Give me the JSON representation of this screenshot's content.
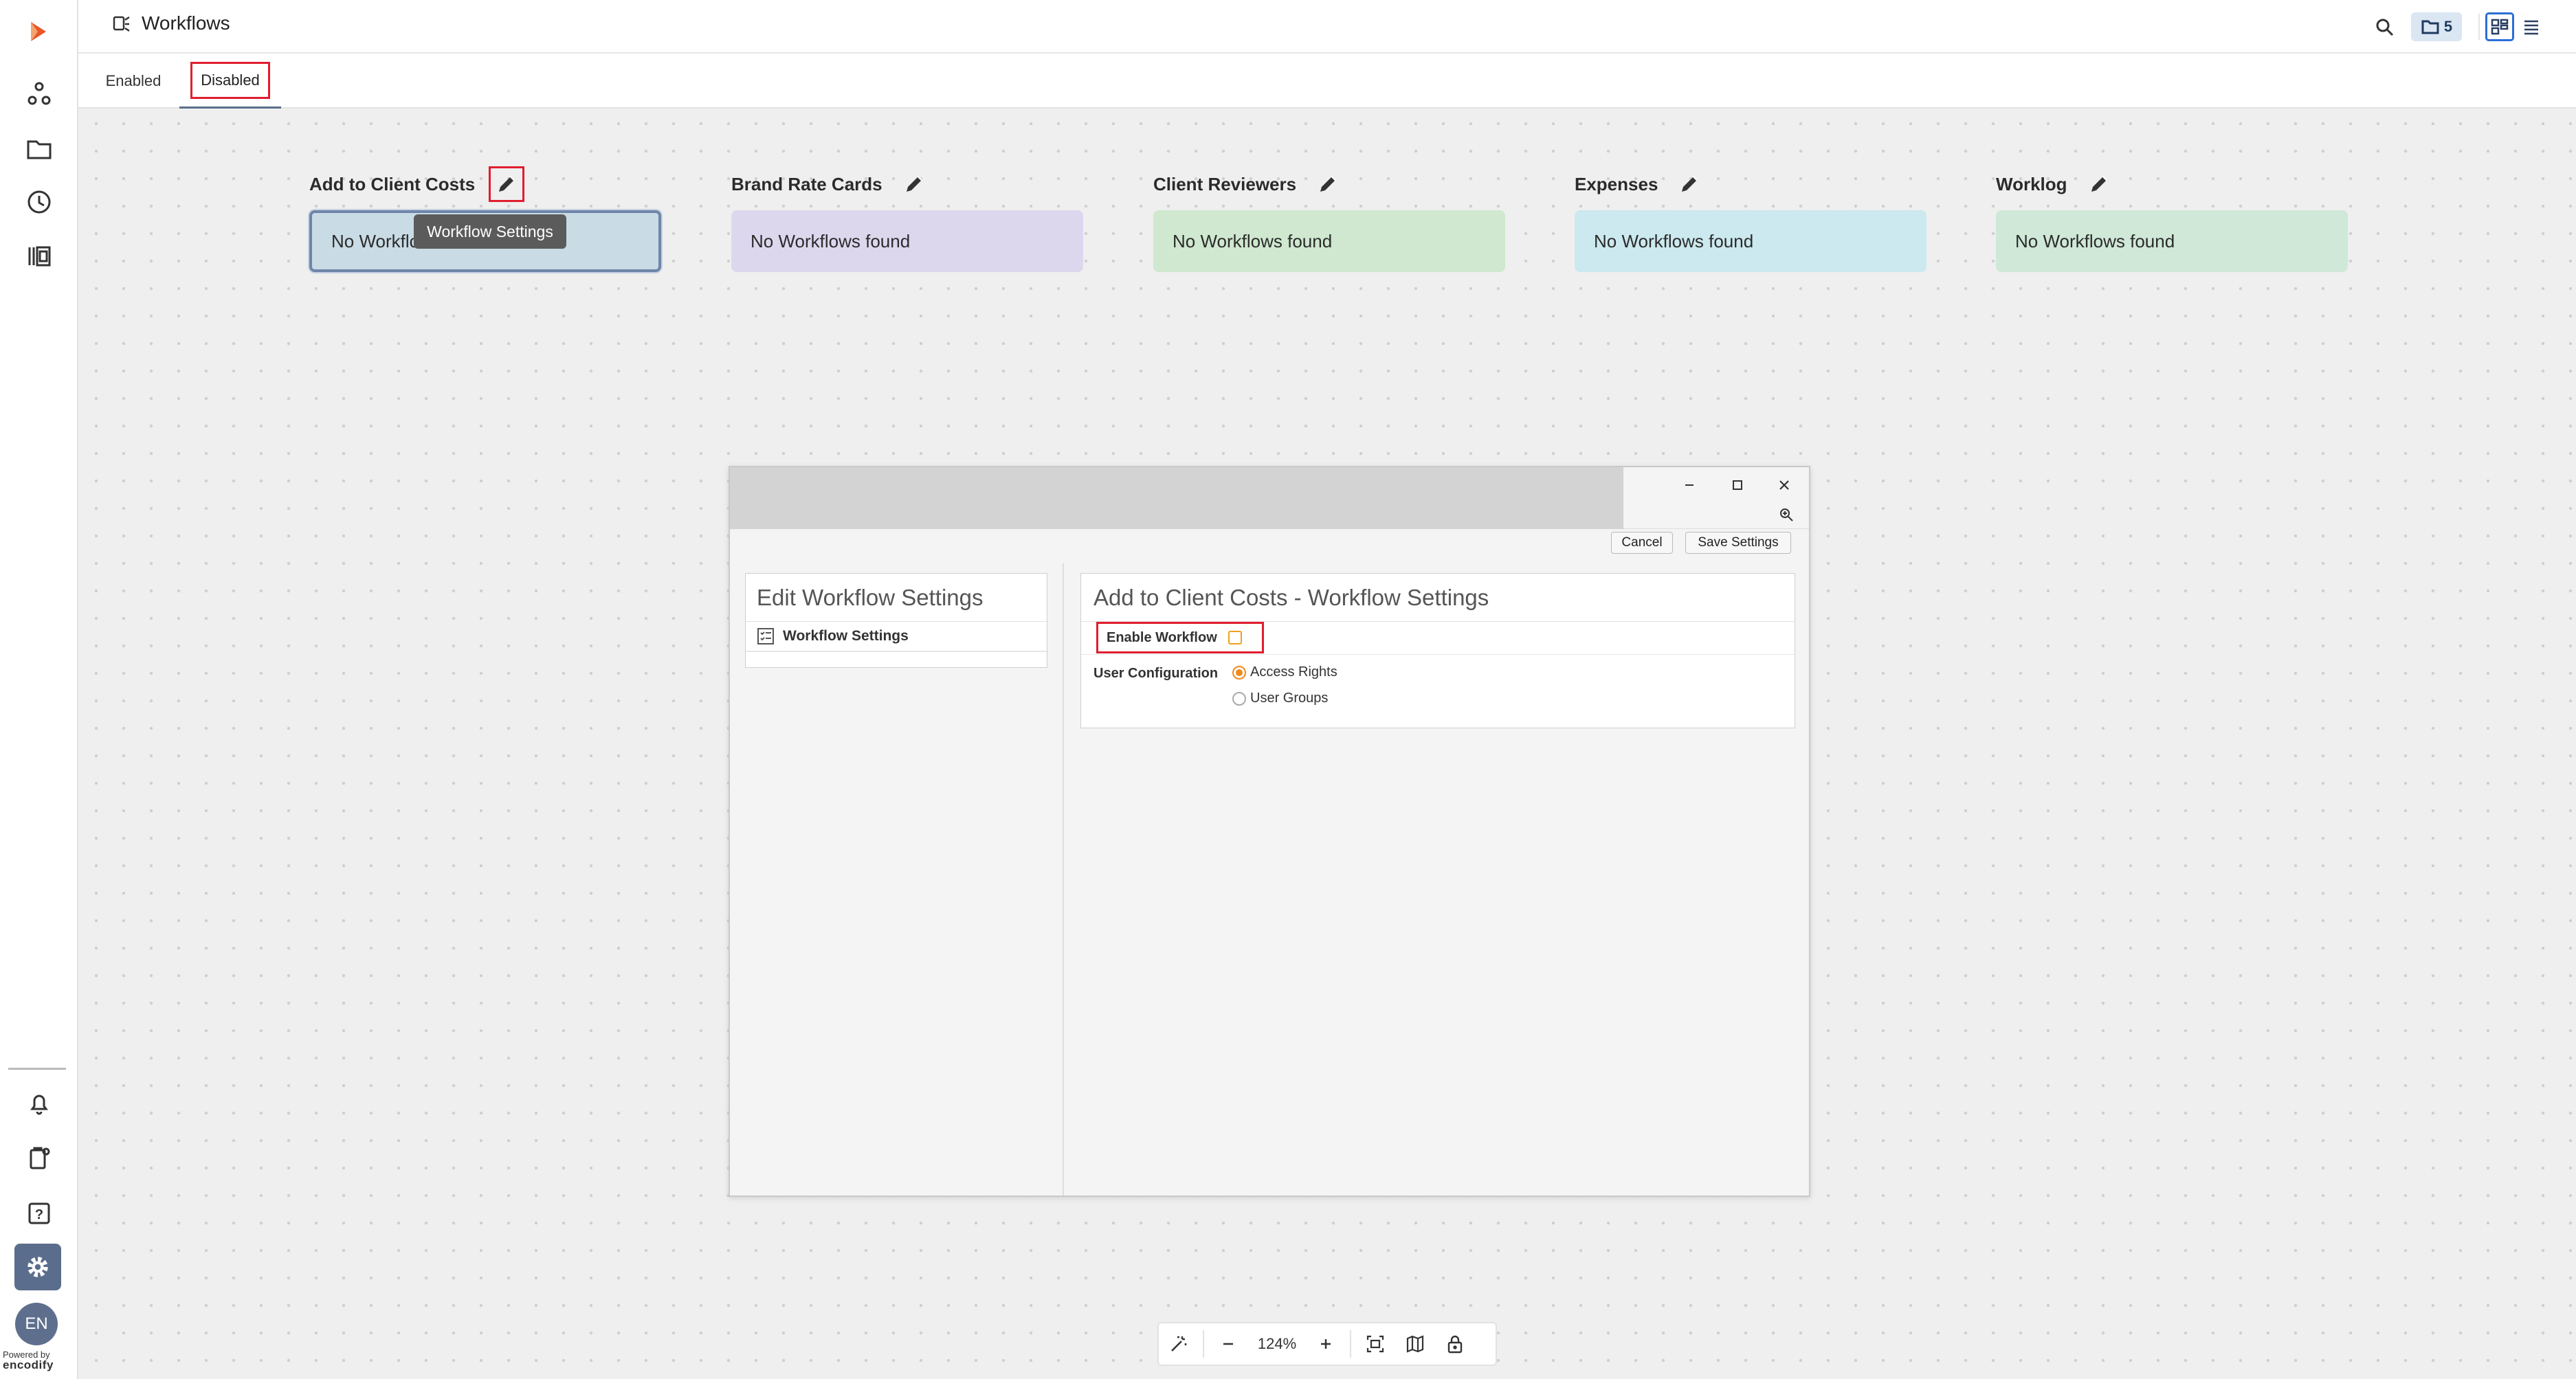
{
  "app": {
    "powered_by": "Powered by",
    "brand": "encodify",
    "language": "EN"
  },
  "header": {
    "title": "Workflows",
    "folder_count": "5"
  },
  "tabs": [
    {
      "label": "Enabled"
    },
    {
      "label": "Disabled",
      "active": true
    }
  ],
  "workflow_columns": [
    {
      "title": "Add to Client Costs",
      "empty_text": "No Workflows found",
      "visible_text": "No Workflc",
      "color": "#c9dbe5"
    },
    {
      "title": "Brand Rate Cards",
      "empty_text": "No Workflows found",
      "color": "#ddd7ee"
    },
    {
      "title": "Client Reviewers",
      "empty_text": "No Workflows found",
      "color": "#cfe8cf"
    },
    {
      "title": "Expenses",
      "empty_text": "No Workflows found",
      "color": "#cbe9ee"
    },
    {
      "title": "Worklog",
      "empty_text": "No Workflows found",
      "color": "#cfe8d8"
    }
  ],
  "tooltip": {
    "text": "Workflow Settings"
  },
  "dialog": {
    "cancel_label": "Cancel",
    "save_label": "Save Settings",
    "left_panel": {
      "title": "Edit Workflow Settings",
      "items": [
        {
          "label": "Workflow Settings"
        }
      ]
    },
    "right_panel": {
      "title": "Add to Client Costs - Workflow Settings",
      "enable_label": "Enable Workflow",
      "enable_checked": false,
      "user_config_label": "User Configuration",
      "options": [
        {
          "label": "Access Rights",
          "checked": true
        },
        {
          "label": "User Groups",
          "checked": false
        }
      ]
    }
  },
  "zoom_bar": {
    "zoom": "124%"
  },
  "colors": {
    "accent": "#5b6d8c",
    "highlight": "#e01e2e",
    "orange": "#f08a1c",
    "brand_logo": "#e8562a"
  }
}
